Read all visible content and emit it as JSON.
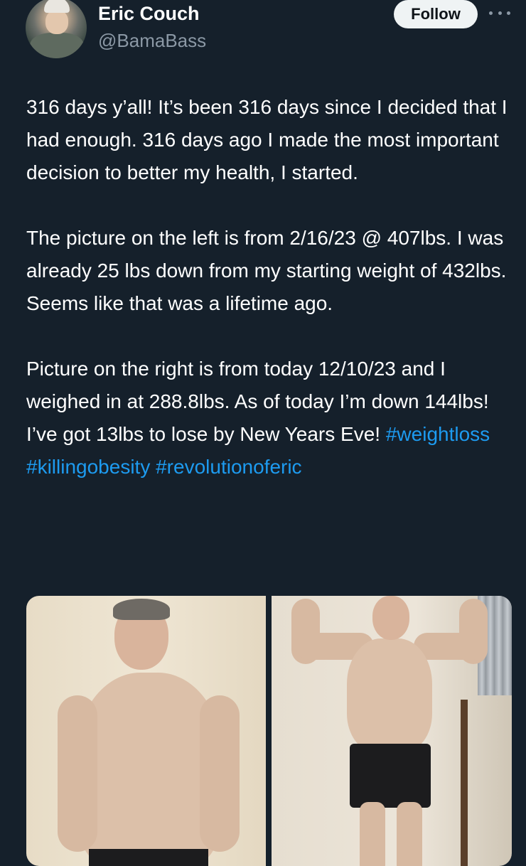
{
  "author": {
    "display_name": "Eric Couch",
    "handle": "@BamaBass",
    "avatar_icon": "profile-photo"
  },
  "actions": {
    "follow_label": "Follow",
    "more_icon": "more-dots-icon"
  },
  "tweet": {
    "paragraph1": "316 days y’all! It’s been 316 days since I decided that I had enough. 316 days ago I made the most important decision to better my health, I started.",
    "paragraph2": "The picture on the left is from 2/16/23 @ 407lbs. I was already 25 lbs down from my starting weight of 432lbs. Seems like that was a lifetime ago.",
    "paragraph3_text": "Picture on the right is from today 12/10/23 and I weighed in at 288.8lbs. As of today I’m down 144lbs! I’ve got 13lbs to lose by New Years Eve! ",
    "hashtags": [
      "#weightloss",
      "#killingobesity",
      "#revolutionoferic"
    ]
  },
  "colors": {
    "background": "#15202b",
    "text": "#ffffff",
    "secondary_text": "#8b98a5",
    "link": "#1d9bf0",
    "follow_button_bg": "#eff3f4"
  }
}
